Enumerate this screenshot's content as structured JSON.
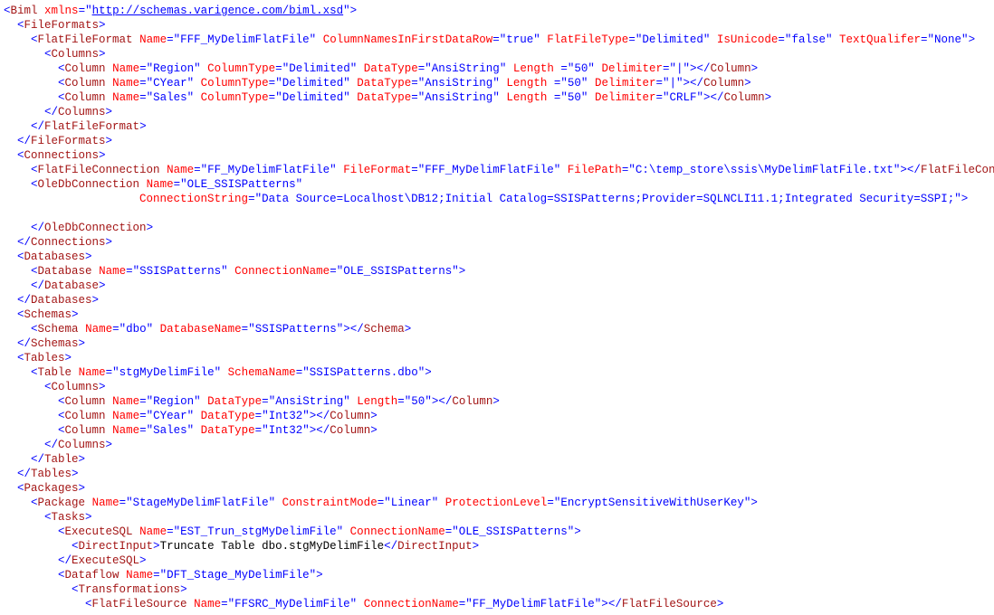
{
  "url": "http://schemas.varigence.com/biml.xsd",
  "fff": {
    "name": "FFF_MyDelimFlatFile",
    "colNamesFirst": "true",
    "type": "Delimited",
    "isUnicode": "false",
    "textQual": "None",
    "cols": [
      {
        "name": "Region",
        "colType": "Delimited",
        "dataType": "AnsiString",
        "len": "50",
        "delim": "|"
      },
      {
        "name": "CYear",
        "colType": "Delimited",
        "dataType": "AnsiString",
        "len": "50",
        "delim": "|"
      },
      {
        "name": "Sales",
        "colType": "Delimited",
        "dataType": "AnsiString",
        "len": "50",
        "delim": "CRLF"
      }
    ]
  },
  "ffc": {
    "name": "FF_MyDelimFlatFile",
    "fileFormat": "FFF_MyDelimFlatFile",
    "filePath": "C:\\temp_store\\ssis\\MyDelimFlatFile.txt"
  },
  "ole": {
    "name": "OLE_SSISPatterns",
    "connStr": "Data Source=Localhost\\DB12;Initial Catalog=SSISPatterns;Provider=SQLNCLI11.1;Integrated Security=SSPI;"
  },
  "db": {
    "name": "SSISPatterns",
    "connName": "OLE_SSISPatterns"
  },
  "schema": {
    "name": "dbo",
    "dbName": "SSISPatterns"
  },
  "table": {
    "name": "stgMyDelimFile",
    "schemaName": "SSISPatterns.dbo",
    "cols": [
      {
        "name": "Region",
        "dataType": "AnsiString",
        "len": "50"
      },
      {
        "name": "CYear",
        "dataType": "Int32"
      },
      {
        "name": "Sales",
        "dataType": "Int32"
      }
    ]
  },
  "pkg": {
    "name": "StageMyDelimFlatFile",
    "constraint": "Linear",
    "protection": "EncryptSensitiveWithUserKey",
    "execSql": {
      "name": "EST_Trun_stgMyDelimFile",
      "conn": "OLE_SSISPatterns",
      "direct": "Truncate Table dbo.stgMyDelimFile"
    },
    "dataflow": {
      "name": "DFT_Stage_MyDelimFile",
      "ffsrc": {
        "name": "FFSRC_MyDelimFile",
        "conn": "FF_MyDelimFlatFile"
      }
    }
  }
}
